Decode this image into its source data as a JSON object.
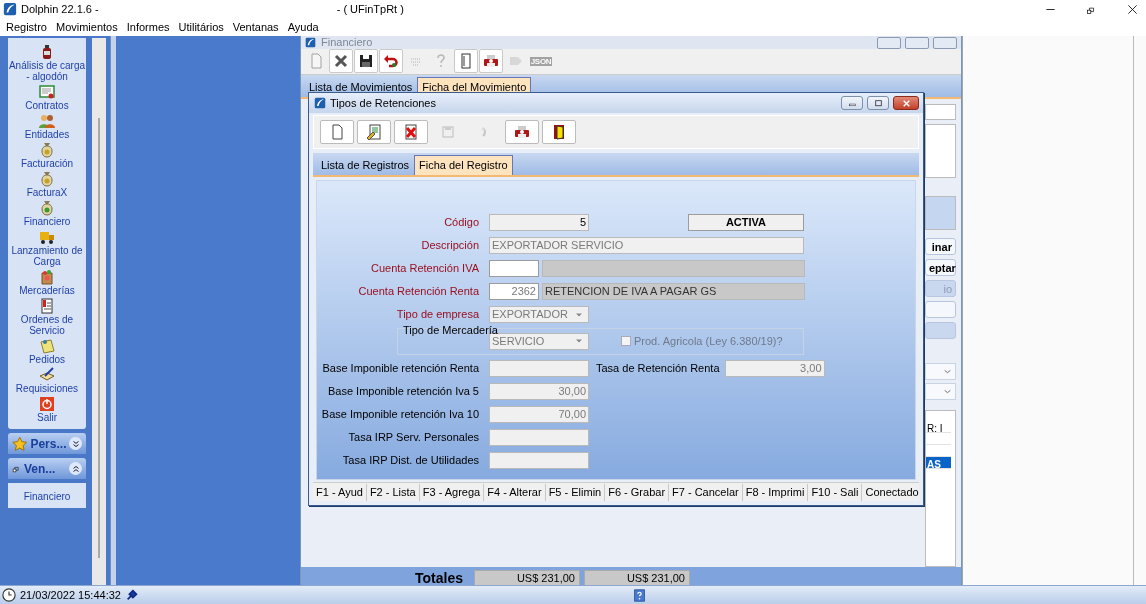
{
  "window": {
    "title": "Dolphin 22.1.6 -",
    "title_suffix": "- ( UFinTpRt )"
  },
  "menu": [
    "Registro",
    "Movimientos",
    "Informes",
    "Utilitários",
    "Ventanas",
    "Ayuda"
  ],
  "sidebar": {
    "items": [
      {
        "label": "Análisis de carga - algodón"
      },
      {
        "label": "Contratos"
      },
      {
        "label": "Entidades"
      },
      {
        "label": "Facturación"
      },
      {
        "label": "FacturaX"
      },
      {
        "label": "Financiero"
      },
      {
        "label": "Lanzamiento de Carga"
      },
      {
        "label": "Mercaderías"
      },
      {
        "label": "Ordenes de Servicio"
      },
      {
        "label": "Pedidos"
      },
      {
        "label": "Requisiciones"
      },
      {
        "label": "Salir"
      }
    ],
    "groups": [
      {
        "label": "Pers...",
        "expanded": false
      },
      {
        "label": "Ven...",
        "expanded": true,
        "children": [
          {
            "label": "Financiero"
          }
        ]
      }
    ]
  },
  "background_window": {
    "title": "Financiero",
    "toolbar": [
      {
        "disabled": true
      },
      {
        "disabled": false
      },
      {
        "disabled": false
      },
      {
        "disabled": false
      },
      {
        "disabled": true
      },
      {
        "disabled": true
      },
      {
        "disabled": false
      },
      {
        "disabled": false
      },
      {
        "disabled": true
      },
      {
        "disabled": true,
        "label": "JSON"
      }
    ],
    "tabs": [
      {
        "label": "Lista de Movimientos",
        "selected": false
      },
      {
        "label": "Ficha del Movimiento",
        "selected": true
      }
    ],
    "side_buttons": [
      {
        "label": "inar",
        "disabled": false
      },
      {
        "label": "eptar",
        "disabled": false
      },
      {
        "label": "io",
        "disabled": true
      },
      {
        "disabled": false
      },
      {
        "disabled": true
      }
    ],
    "table_rows": [
      {
        "text": "R: I",
        "selected": false
      },
      {
        "selected": false
      },
      {
        "selected": false
      },
      {
        "text": "AS",
        "selected": true
      }
    ],
    "totals": {
      "label": "Totales",
      "values": [
        "US$ 231,00",
        "US$ 231,00"
      ]
    }
  },
  "dialog": {
    "title": "Tipos de Retenciones",
    "toolbar": [
      {
        "disabled": false
      },
      {
        "disabled": false
      },
      {
        "disabled": false
      },
      {
        "disabled": true
      },
      {
        "disabled": true
      },
      {
        "disabled": false
      },
      {
        "disabled": false
      }
    ],
    "tabs": [
      {
        "label": "Lista de Registros",
        "selected": false
      },
      {
        "label": "Ficha del Registro",
        "selected": true
      }
    ],
    "status_badge": "ACTIVA",
    "rows": [
      {
        "kind": "row",
        "label": "Código",
        "required": true,
        "fields": [
          {
            "kind": "readonly",
            "value": "5",
            "disabled": false
          }
        ]
      },
      {
        "kind": "row",
        "label": "Descripción",
        "required": true,
        "fields": [
          {
            "kind": "long",
            "value": "EXPORTADOR SERVICIO",
            "disabled": true
          }
        ]
      },
      {
        "kind": "row",
        "label": "Cuenta Retención IVA",
        "required": true,
        "fields": [
          {
            "kind": "input"
          },
          {
            "kind": "name"
          }
        ]
      },
      {
        "kind": "row",
        "label": "Cuenta Retención Renta",
        "required": true,
        "fields": [
          {
            "kind": "input",
            "value": "2362",
            "disabled": true
          },
          {
            "kind": "name",
            "value": "RETENCION DE IVA A PAGAR GS",
            "disabled": true
          }
        ]
      },
      {
        "kind": "row",
        "label": "Tipo de empresa",
        "required": true,
        "fields": [
          {
            "kind": "select",
            "value": "EXPORTADOR",
            "disabled": true
          }
        ]
      },
      {
        "kind": "group",
        "legend": "Tipo de Mercadería",
        "select": {
          "value": "SERVICIO",
          "disabled": true
        },
        "checkbox": {
          "label": "Prod. Agricola (Ley 6.380/19)?",
          "checked": false,
          "disabled": true
        }
      },
      {
        "kind": "row",
        "label": "Base Imponible retención Renta",
        "required": false,
        "fields": [
          {
            "kind": "text",
            "disabled": true
          }
        ],
        "side": {
          "label": "Tasa de Retención Renta",
          "field": {
            "kind": "text",
            "value": "3,00",
            "disabled": true
          }
        }
      },
      {
        "kind": "row",
        "label": "Base Imponible retención Iva 5",
        "required": false,
        "fields": [
          {
            "kind": "text",
            "value": "30,00",
            "disabled": true
          }
        ]
      },
      {
        "kind": "row",
        "label": "Base Imponible retención Iva 10",
        "required": false,
        "fields": [
          {
            "kind": "text",
            "value": "70,00",
            "disabled": true
          }
        ]
      },
      {
        "kind": "row",
        "label": "Tasa IRP Serv. Personales",
        "required": false,
        "fields": [
          {
            "kind": "text",
            "disabled": true
          }
        ]
      },
      {
        "kind": "row",
        "label": "Tasa IRP Dist. de Utilidades",
        "required": false,
        "fields": [
          {
            "kind": "text",
            "disabled": true
          }
        ]
      }
    ],
    "function_keys": [
      "F1 - Ayud",
      "F2 - Lista",
      "F3 - Agrega",
      "F4 - Alterar",
      "F5 - Elimin",
      "F6 - Grabar",
      "F7 - Cancelar",
      "F8 - Imprimi",
      "F10 - Sali"
    ],
    "connection": "Conectado"
  },
  "status_bar": {
    "datetime": "21/03/2022 15:44:32"
  }
}
